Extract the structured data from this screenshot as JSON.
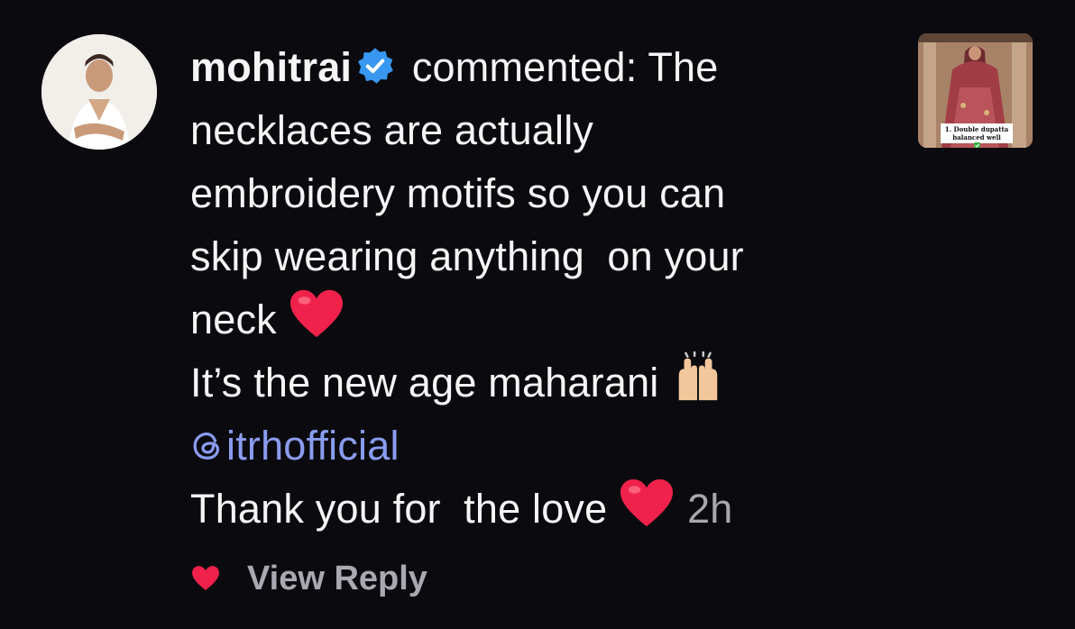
{
  "comment": {
    "username": "mohitrai",
    "lines": [
      " commented: The",
      "necklaces are actually",
      "embroidery motifs so you can",
      "skip wearing anything  on your",
      "neck",
      "It’s the new age maharani",
      "Thank you for  the love"
    ],
    "mention": "itrhofficial",
    "timestamp": "2h",
    "emojis": {
      "heart": "❤️",
      "raised_hands": "🙌"
    }
  },
  "thumbnail": {
    "caption_line1": "1. Double dupatta",
    "caption_line2": "balanced well"
  },
  "actions": {
    "view_reply_label": "View Reply"
  },
  "icons": [
    "verified-badge-icon",
    "threads-icon",
    "heart-icon",
    "like-heart-icon",
    "raised-hands-icon"
  ],
  "colors": {
    "background": "#0b0b0f",
    "text": "#f5f5f5",
    "mention": "#8a9cf0",
    "verified": "#3897f0",
    "heart": "#f0224b",
    "muted": "#a8a8ae"
  }
}
